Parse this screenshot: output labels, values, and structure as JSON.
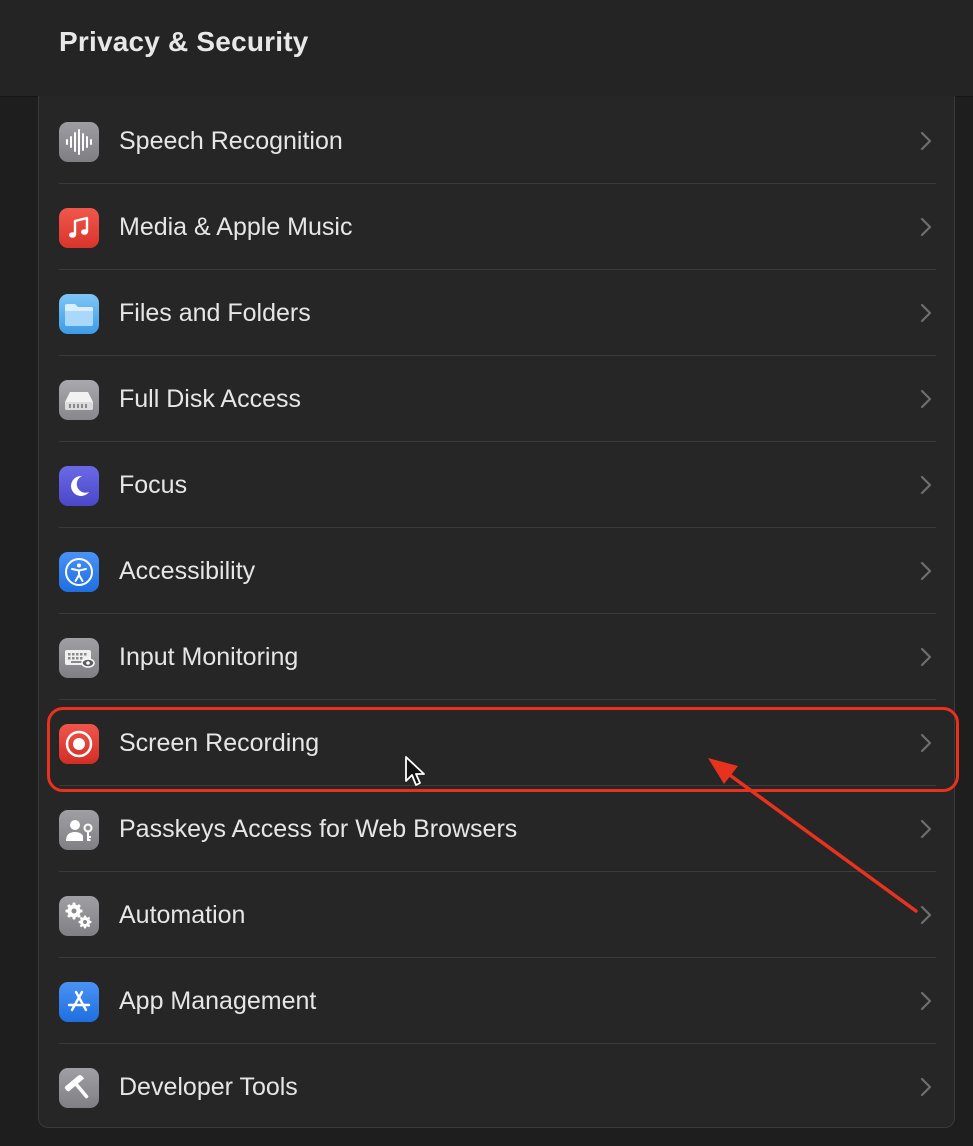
{
  "window": {
    "title": "Privacy & Security"
  },
  "list": {
    "items": [
      {
        "label": "Speech Recognition",
        "icon": "waveform-icon",
        "icon_bg": "#8e8e93"
      },
      {
        "label": "Media & Apple Music",
        "icon": "music-note-icon",
        "icon_bg": "#e5453c"
      },
      {
        "label": "Files and Folders",
        "icon": "folder-icon",
        "icon_bg": "#5ab0f0"
      },
      {
        "label": "Full Disk Access",
        "icon": "disk-drive-icon",
        "icon_bg": "#9a9a9e"
      },
      {
        "label": "Focus",
        "icon": "moon-icon",
        "icon_bg": "#5856d6"
      },
      {
        "label": "Accessibility",
        "icon": "accessibility-icon",
        "icon_bg": "#2f7ff0"
      },
      {
        "label": "Input Monitoring",
        "icon": "keyboard-eye-icon",
        "icon_bg": "#8e8e93"
      },
      {
        "label": "Screen Recording",
        "icon": "record-icon",
        "icon_bg": "#e23b34"
      },
      {
        "label": "Passkeys Access for Web Browsers",
        "icon": "person-key-icon",
        "icon_bg": "#8e8e93"
      },
      {
        "label": "Automation",
        "icon": "gears-icon",
        "icon_bg": "#8e8e93"
      },
      {
        "label": "App Management",
        "icon": "app-store-icon",
        "icon_bg": "#2f7ff0"
      },
      {
        "label": "Developer Tools",
        "icon": "hammer-icon",
        "icon_bg": "#8e8e93"
      }
    ]
  },
  "annotation": {
    "highlight_color": "#e8321e",
    "highlighted_item": "Screen Recording"
  }
}
